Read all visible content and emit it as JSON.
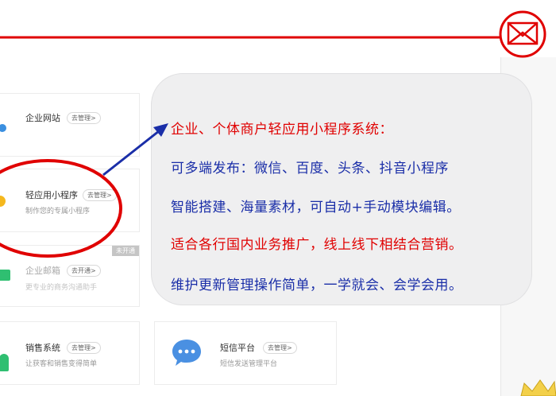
{
  "services": [
    {
      "title": "企业网站",
      "tag": "去管理>",
      "sub": ""
    },
    {
      "title": "轻应用小程序",
      "tag": "去管理>",
      "sub": "制作您的专属小程序"
    },
    {
      "title": "企业邮箱",
      "tag": "去开通>",
      "sub": "更专业的商务沟通助手",
      "ribbon": "未开通"
    },
    {
      "title": "销售系统",
      "tag": "去管理>",
      "sub": "让获客和销售变得简单"
    },
    {
      "title": "短信平台",
      "tag": "去管理>",
      "sub": "短信发送管理平台"
    }
  ],
  "callout": {
    "lines": [
      "企业、个体商户轻应用小程序系统：",
      "可多端发布：微信、百度、头条、抖音小程序",
      "智能搭建、海量素材，可自动+手动模块编辑。",
      "适合各行国内业务推广，线上线下相结合营销。",
      "维护更新管理操作简单，一学就会、会学会用。"
    ]
  },
  "colors": {
    "annotation_red": "#e00000",
    "annotation_blue": "#1a2ea8",
    "bubble_bg": "#efeff0",
    "mail_green": "#2fbf71",
    "sms_blue": "#4a90e2"
  },
  "icons": [
    "globe-icon",
    "mini-program-icon",
    "mail-icon",
    "user-icon",
    "chat-bubble-icon",
    "envelope-stamp-icon",
    "crown-icon"
  ]
}
